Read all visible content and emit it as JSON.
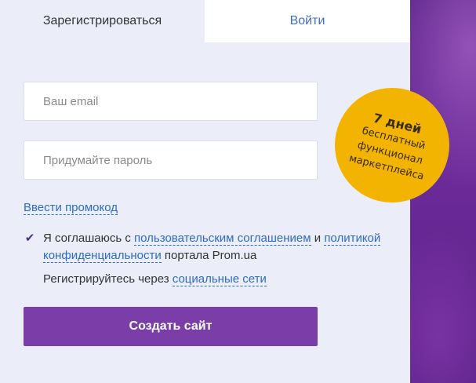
{
  "tabs": {
    "register": "Зарегистрироваться",
    "login": "Войти"
  },
  "form": {
    "email_placeholder": "Ваш email",
    "password_placeholder": "Придумайте пароль",
    "promo_link": "Ввести промокод",
    "agreement": {
      "checked": true,
      "prefix": "Я соглашаюсь с",
      "user_agreement_link": "пользовательским соглашением",
      "and": "и",
      "privacy_link": "политикой конфиденциальности",
      "suffix": "портала Prom.ua"
    },
    "social": {
      "prefix": "Регистрируйтесь через",
      "link": "социальные сети"
    },
    "submit_label": "Создать сайт"
  },
  "badge": {
    "title": "7 дней",
    "line1": "бесплатный",
    "line2": "функционал",
    "line3": "маркетплейса"
  },
  "colors": {
    "accent": "#7b3ea8",
    "link": "#2f6bc2",
    "badge": "#f2b400",
    "background": "#5a2287"
  }
}
